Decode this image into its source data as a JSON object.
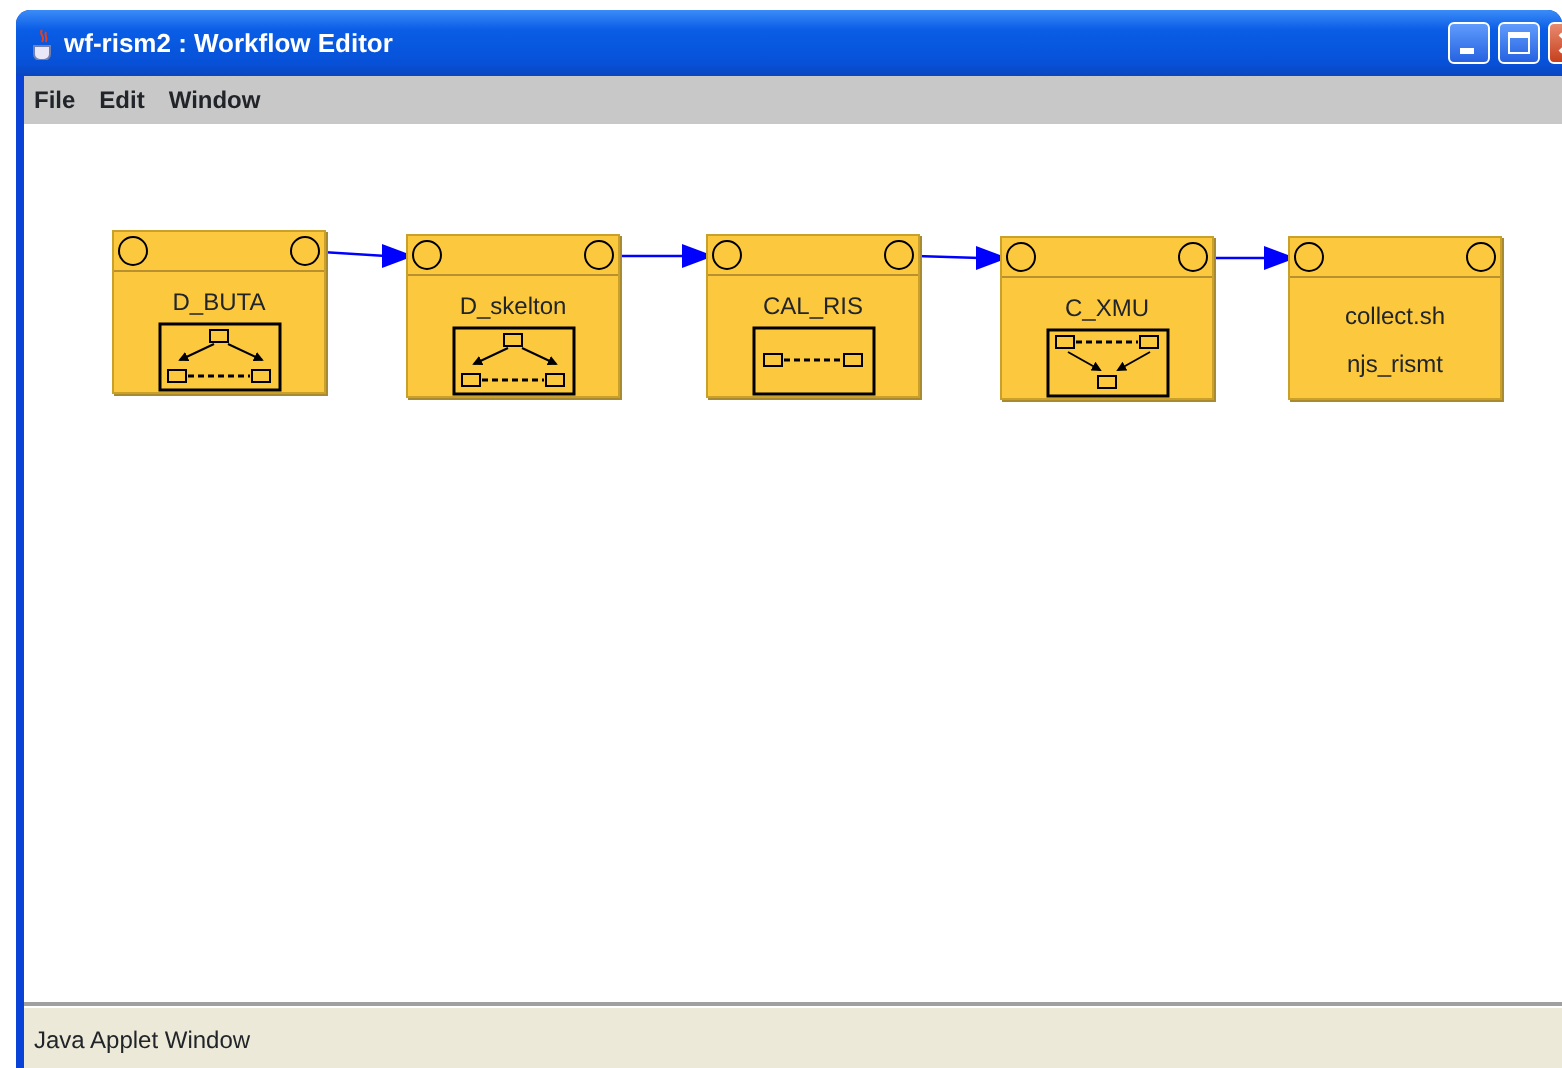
{
  "window": {
    "title": "wf-rism2 : Workflow Editor"
  },
  "menu": [
    "File",
    "Edit",
    "Window"
  ],
  "nodes": [
    {
      "kind": "job",
      "label": "D_BUTA",
      "icon": {
        "kind": "fan-out"
      }
    },
    {
      "kind": "job",
      "label": "D_skelton",
      "icon": {
        "kind": "fan-out"
      }
    },
    {
      "kind": "job",
      "label": "CAL_RIS",
      "icon": {
        "kind": "chain"
      }
    },
    {
      "kind": "job",
      "label": "C_XMU",
      "icon": {
        "kind": "fan-in"
      }
    },
    {
      "kind": "script",
      "lines": [
        "collect.sh",
        "njs_rismt"
      ]
    }
  ],
  "status_bar": "Java Applet Window"
}
